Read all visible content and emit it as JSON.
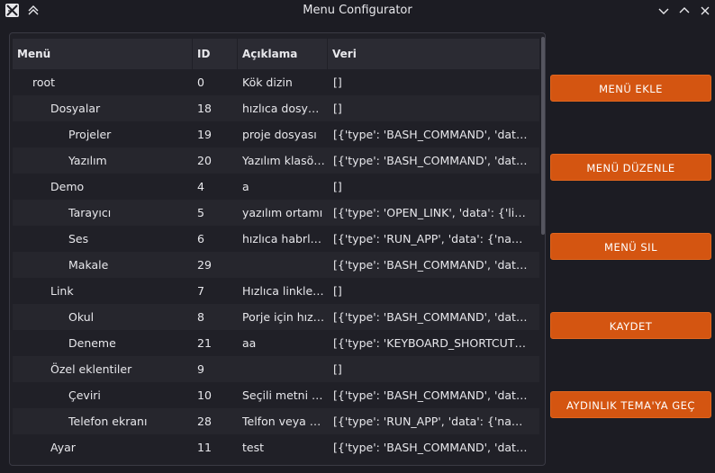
{
  "window": {
    "title": "Menu Configurator",
    "icons": [
      "app-icon",
      "keep-above-icon",
      "minimize-icon",
      "maximize-icon",
      "close-icon"
    ]
  },
  "table": {
    "headers": {
      "name": "Menü",
      "id": "ID",
      "description": "Açıklama",
      "data": "Veri"
    },
    "rows": [
      {
        "name": "root",
        "level": 0,
        "id": "0",
        "description": "Kök dizin",
        "data": "[]"
      },
      {
        "name": "Dosyalar",
        "level": 1,
        "id": "18",
        "description": "hızlıca dosya…",
        "data": "[]"
      },
      {
        "name": "Projeler",
        "level": 2,
        "id": "19",
        "description": "proje dosyası",
        "data": "[{'type': 'BASH_COMMAND', 'data':…"
      },
      {
        "name": "Yazılım",
        "level": 2,
        "id": "20",
        "description": "Yazılım klasörü",
        "data": "[{'type': 'BASH_COMMAND', 'data':…"
      },
      {
        "name": "Demo",
        "level": 1,
        "id": "4",
        "description": "a",
        "data": "[]"
      },
      {
        "name": "Tarayıcı",
        "level": 2,
        "id": "5",
        "description": "yazılım ortamı",
        "data": "[{'type': 'OPEN_LINK', 'data': {'links…"
      },
      {
        "name": "Ses",
        "level": 2,
        "id": "6",
        "description": "hızlıca habrl…",
        "data": "[{'type': 'RUN_APP', 'data': {'name':…"
      },
      {
        "name": "Makale",
        "level": 2,
        "id": "29",
        "description": "",
        "data": "[{'type': 'BASH_COMMAND', 'data':…"
      },
      {
        "name": "Link",
        "level": 1,
        "id": "7",
        "description": "Hızlıca linkle…",
        "data": "[]"
      },
      {
        "name": "Okul",
        "level": 2,
        "id": "8",
        "description": "Porje için hız…",
        "data": "[{'type': 'BASH_COMMAND', 'data':…"
      },
      {
        "name": "Deneme",
        "level": 2,
        "id": "21",
        "description": "aa",
        "data": "[{'type': 'KEYBOARD_SHORTCUT'…"
      },
      {
        "name": "Özel eklentiler",
        "level": 1,
        "id": "9",
        "description": "",
        "data": "[]"
      },
      {
        "name": "Çeviri",
        "level": 2,
        "id": "10",
        "description": "Seçili metni ç…",
        "data": "[{'type': 'BASH_COMMAND', 'data':…"
      },
      {
        "name": "Telefon ekranı",
        "level": 2,
        "id": "28",
        "description": "Telfon veya t…",
        "data": "[{'type': 'RUN_APP', 'data': {'name':…"
      },
      {
        "name": "Ayar",
        "level": 1,
        "id": "11",
        "description": "test",
        "data": "[{'type': 'BASH_COMMAND', 'data':…"
      }
    ]
  },
  "buttons": {
    "add": "MENÜ EKLE",
    "edit": "MENÜ DÜZENLE",
    "delete": "MENÜ SIL",
    "save": "KAYDET",
    "theme": "AYDINLIK TEMA'YA GEÇ"
  },
  "colors": {
    "accent": "#d45511",
    "background": "#1c1c23",
    "panel": "#202027",
    "header": "#2b2b33"
  }
}
